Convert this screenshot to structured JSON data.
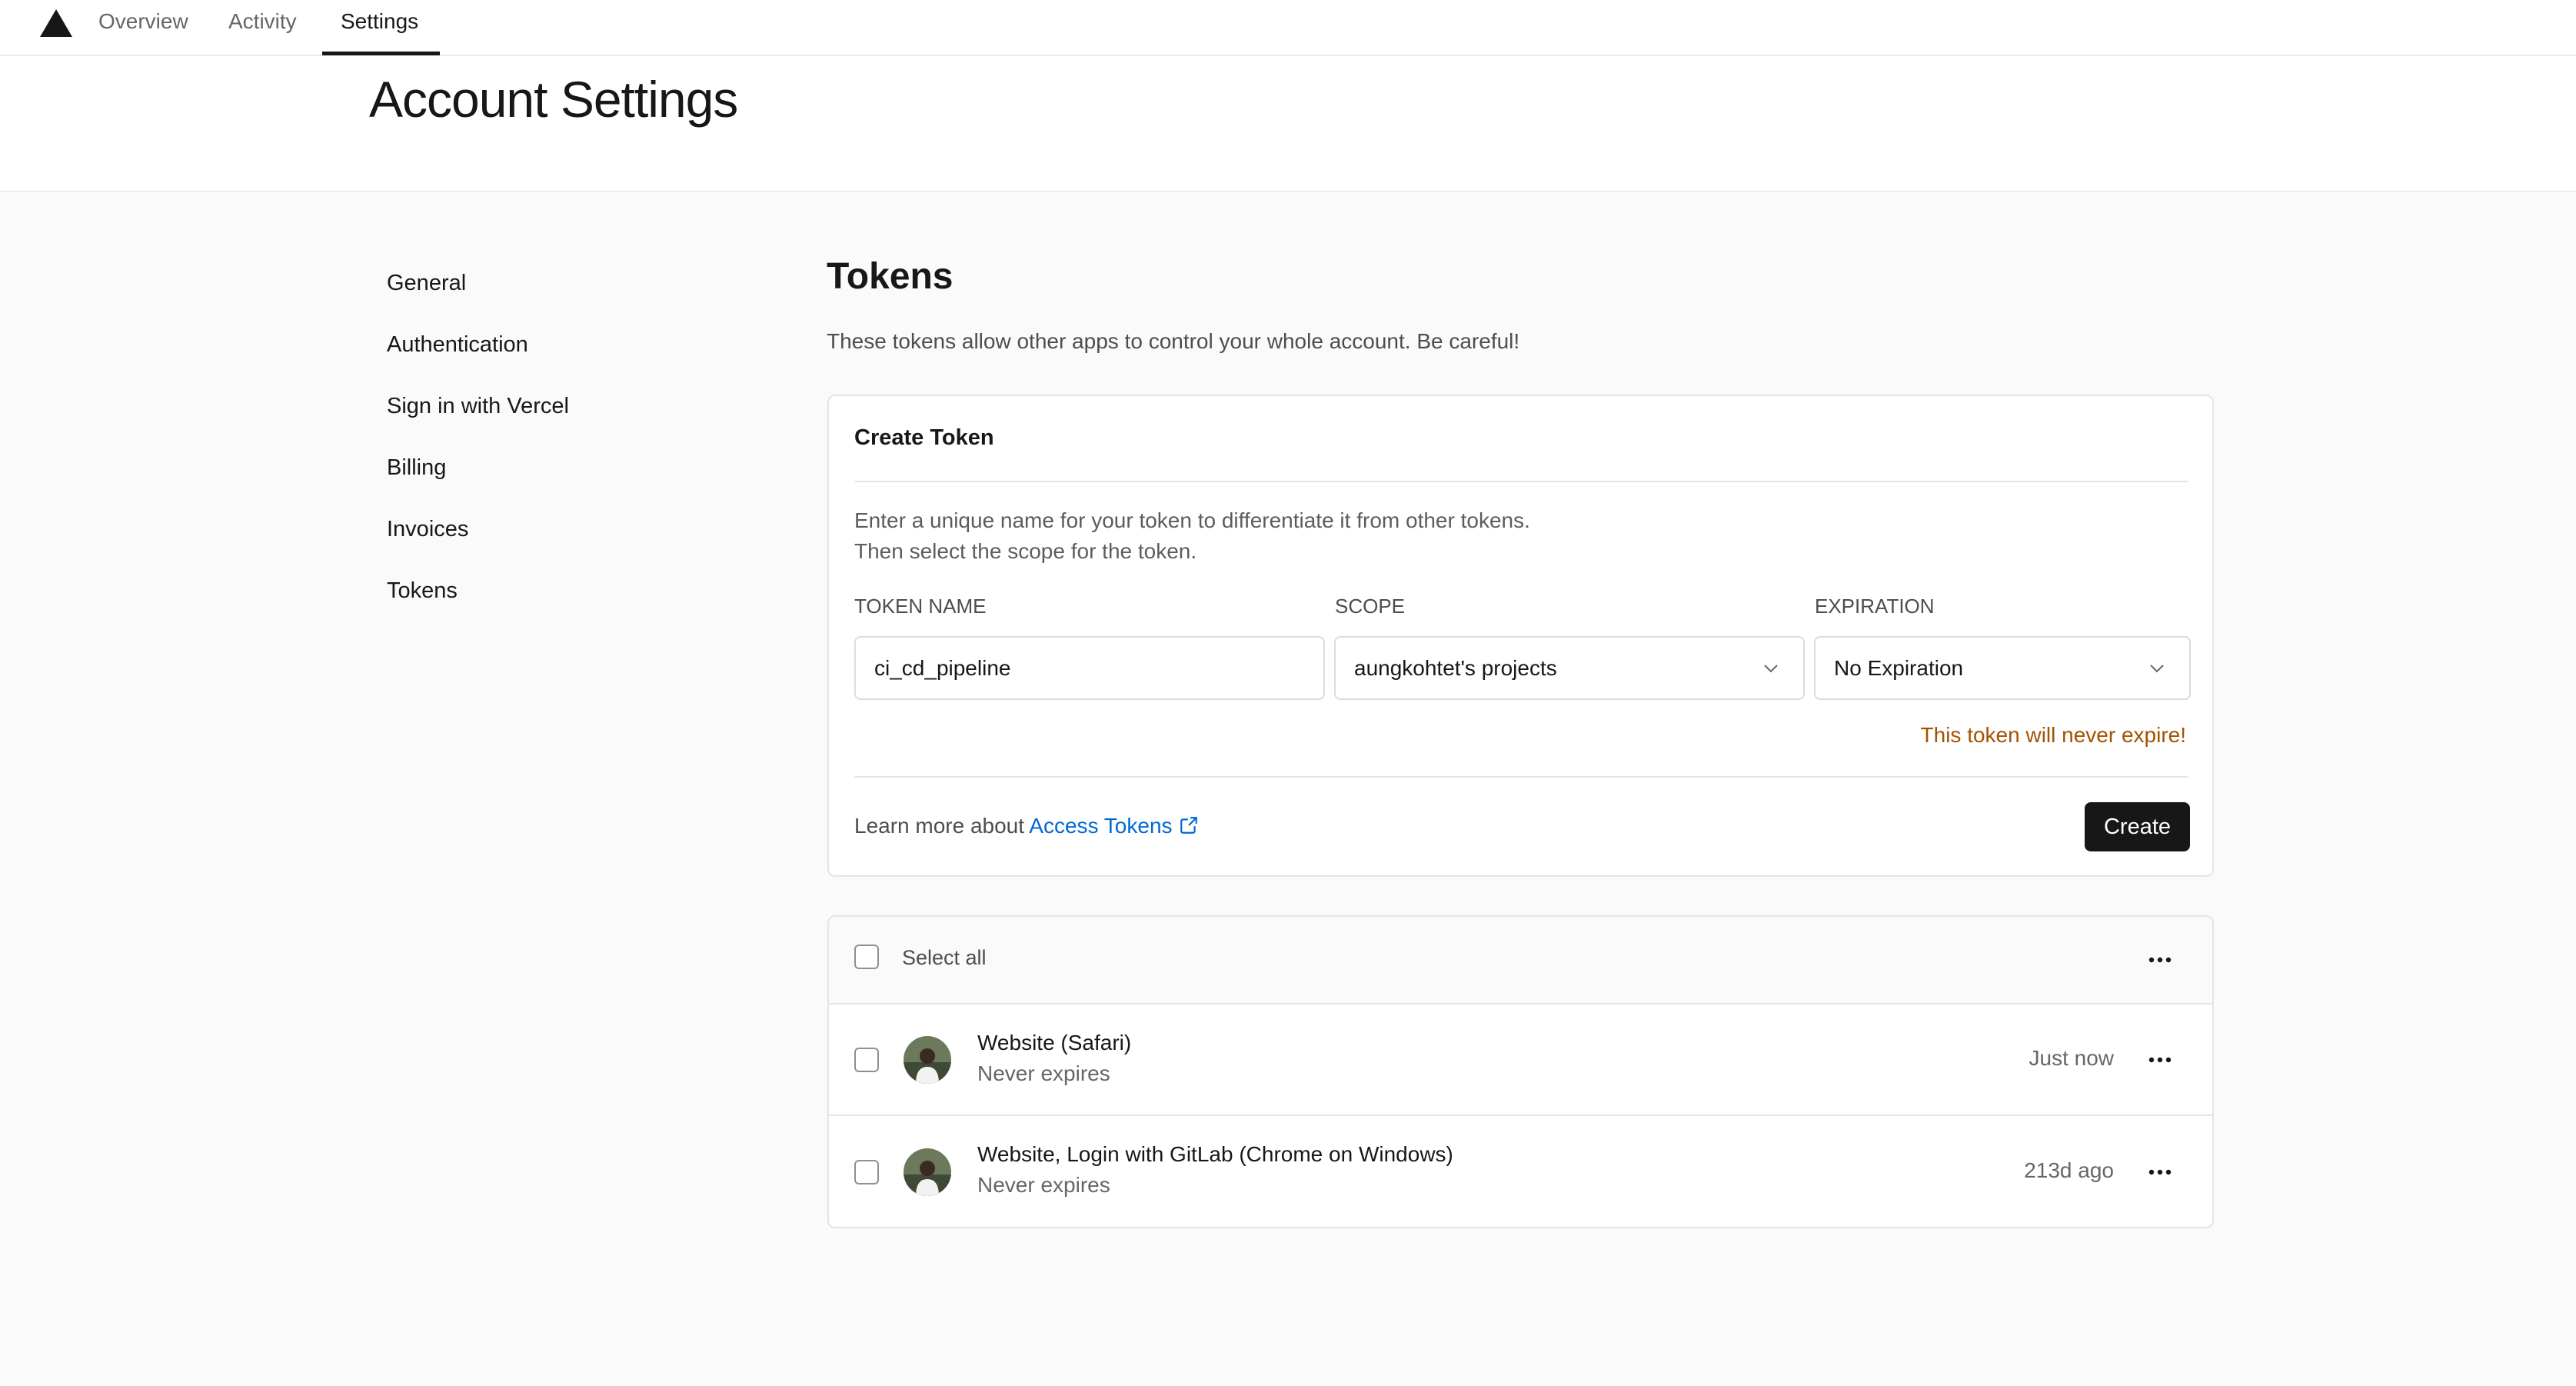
{
  "nav": {
    "logo": "vercel-triangle-logo",
    "tabs": [
      {
        "label": "Overview"
      },
      {
        "label": "Activity"
      },
      {
        "label": "Settings",
        "active": true
      }
    ]
  },
  "header": {
    "title": "Account Settings"
  },
  "sidebar": {
    "items": [
      {
        "label": "General"
      },
      {
        "label": "Authentication"
      },
      {
        "label": "Sign in with Vercel"
      },
      {
        "label": "Billing"
      },
      {
        "label": "Invoices"
      },
      {
        "label": "Tokens",
        "active": true
      }
    ]
  },
  "main": {
    "title": "Tokens",
    "description": "These tokens allow other apps to control your whole account. Be careful!",
    "create_card": {
      "title": "Create Token",
      "instructions_line1": "Enter a unique name for your token to differentiate it from other tokens.",
      "instructions_line2": "Then select the scope for the token.",
      "fields": {
        "token_name": {
          "label": "TOKEN NAME",
          "value": "ci_cd_pipeline"
        },
        "scope": {
          "label": "SCOPE",
          "value": "aungkohtet's projects"
        },
        "expiration": {
          "label": "EXPIRATION",
          "value": "No Expiration"
        }
      },
      "warning": "This token will never expire!",
      "learn_more_prefix": "Learn more about",
      "learn_more_link": "Access Tokens",
      "create_button": "Create"
    },
    "token_list": {
      "select_all": "Select all",
      "tokens": [
        {
          "name": "Website (Safari)",
          "expires": "Never expires",
          "time": "Just now"
        },
        {
          "name": "Website, Login with GitLab (Chrome on Windows)",
          "expires": "Never expires",
          "time": "213d ago"
        }
      ]
    }
  },
  "colors": {
    "accent_link": "#0068d6",
    "warning": "#a35200",
    "button": "#171717",
    "page_bg": "#fafafa"
  }
}
